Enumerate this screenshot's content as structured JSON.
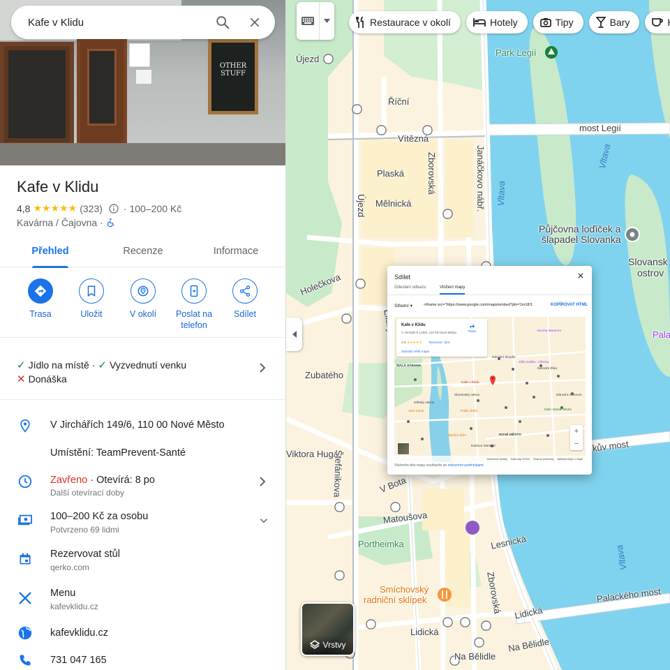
{
  "search": {
    "value": "Kafe v Klidu"
  },
  "hero": {
    "board_text": "OTHER STUFF"
  },
  "place": {
    "name": "Kafe v Klidu",
    "rating": "4,8",
    "stars": "★★★★★",
    "reviews": "(323)",
    "price": "· 100–200 Kč",
    "category": "Kavárna / Čajovna ·"
  },
  "tabs": [
    "Přehled",
    "Recenze",
    "Informace"
  ],
  "actions": [
    "Trasa",
    "Uložit",
    "V okolí",
    "Poslat na telefon",
    "Sdílet"
  ],
  "amenities": {
    "item1": "Jídlo na místě",
    "sep": "·",
    "item2": "Vyzvednutí venku",
    "item3": "Donáška"
  },
  "info": {
    "address": "V Jirchářích 149/6, 110 00 Nové Město",
    "located": "Umístění: TeamPrevent-Santé",
    "status": "Zavřeno",
    "opens": "· Otevírá: 8 po",
    "hours_more": "Další otevírací doby",
    "price_person": "100–200 Kč za osobu",
    "price_confirmed": "Potvrzeno 69 lidmi",
    "reserve": "Rezervovat stůl",
    "reserve_sub": "qerko.com",
    "menu": "Menu",
    "menu_sub": "kafevklidu.cz",
    "website": "kafevklidu.cz",
    "phone": "731 047 165"
  },
  "chips": [
    "Restaurace v okolí",
    "Hotely",
    "Tipy",
    "Bary",
    "Ká"
  ],
  "map_labels": {
    "ujezd_top": "Újezd",
    "park_legii": "Park Legií",
    "ricni": "Říční",
    "vitezna": "Vítězná",
    "most_legii": "most Legií",
    "vltava1": "Vltava",
    "vltava2": "Vltava",
    "vltava3": "Vltava",
    "plaska": "Plaská",
    "zborovska1": "Zborovská",
    "janackovo": "Janáčkovo nábř.",
    "ujezd_v": "Újezd",
    "melnicka": "Mělnická",
    "pujcovna1": "Půjčovna loďiček a",
    "pujcovna2": "šlapadel Slovanka",
    "slovansky1": "Slovansk",
    "slovansky2": "ostrov",
    "holeckova": "Holečkova",
    "elisky": "Elišky Peš.",
    "zubateho": "Zubatého",
    "viktora": "Viktora Huga",
    "stefanikova": "Štefánikova",
    "vbotanice": "V Bota",
    "jiraskuv": "kův most",
    "matousova": "Matoušova",
    "portheimka": "Portheimka",
    "lesnicka": "Lesnická",
    "zborovska2": "Zborovská",
    "smichovsky1": "Smíchovský",
    "smichovsky2": "radniční sklípek",
    "palackeho": "Palackého most",
    "lidicka1": "Lidická",
    "lidicka2": "Lidická",
    "nabelidle1": "Na Bělidle",
    "nabelidle2": "Na Bělidle",
    "pala": "Pala"
  },
  "layers": {
    "label": "Vrstvy"
  },
  "share": {
    "title": "Sdílet",
    "tab_link": "Odeslání odkazu",
    "tab_embed": "Vložení mapy",
    "size": "Střední ▾",
    "code": "<iframe src=\"https://www.google.com/maps/embed?pb=!1m18!1",
    "copy": "KOPÍROVAT HTML",
    "mini": {
      "name": "Kafe v Klidu",
      "address": "V Jirchářích 149/6, 110 00 Nové Město",
      "rating": "4,8",
      "stars": "★★★★★",
      "reviews": "Recenze: 323",
      "larger": "Zobrazit větší mapu",
      "route": "Trasa",
      "labels": {
        "l1": "Mucha Museum",
        "l2": "Národní divadlo",
        "l3": "MALÁ STRANA",
        "l4": "Jídlo Kafka · Ořechy",
        "l5": "Národní třída",
        "l6": "Kafe v Klidu",
        "l7": "Slovanský ostrov",
        "l8": "Dětský ostrov",
        "l9": "Jazz Dock",
        "l10": "Palác Žofín",
        "l11": "Tančící dům",
        "l12": "NOVÉ MĚSTO",
        "l13": "Národní muzeum",
        "l14": "Dalo Veselé Bistro",
        "l15": "Karlovo náměstí"
      },
      "footer": [
        "Klávesové zkratky",
        "Data map ©2024",
        "Smluvní podmínky",
        "Nahlásit chybu v mapě"
      ]
    },
    "foot_text": "Vložením této mapy souhlasíte se",
    "foot_link": "smluvními podmínkami."
  },
  "colors": {
    "accent": "#1a73e8",
    "water": "#7fd3ee",
    "park": "#c7e9c0",
    "land": "#fbf3df"
  }
}
